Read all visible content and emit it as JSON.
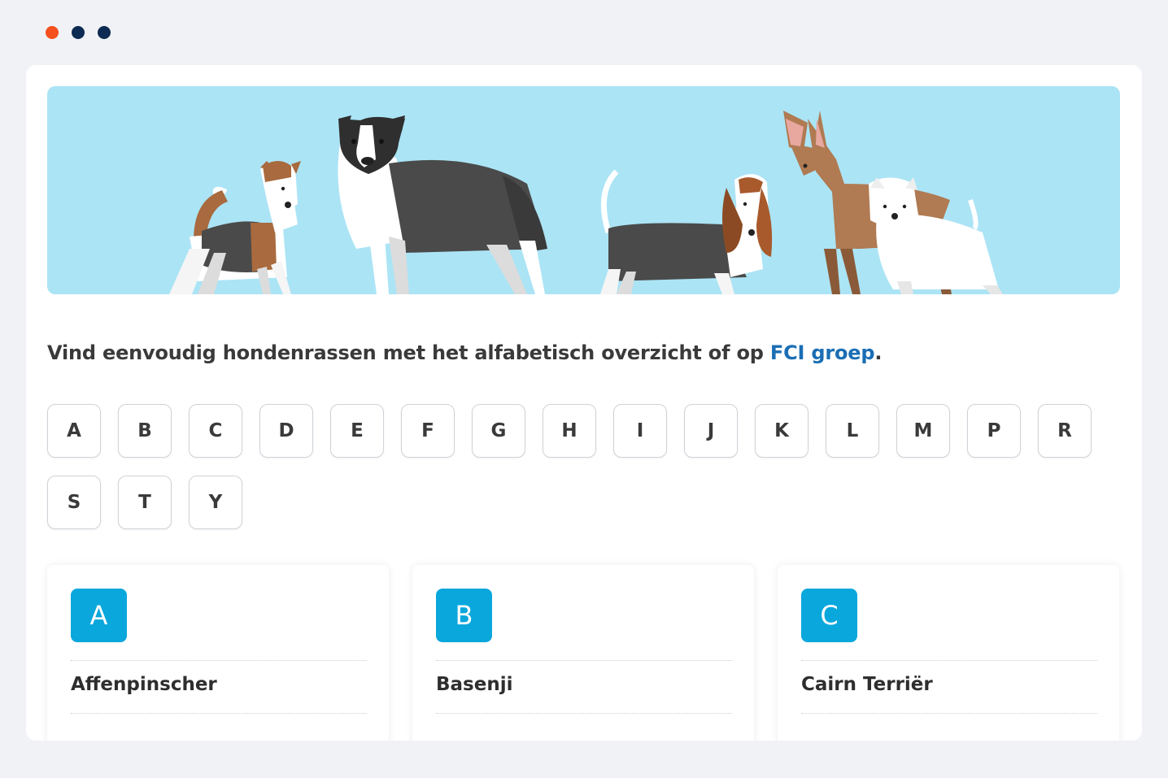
{
  "window": {
    "dot_colors": [
      "#f4511e",
      "#0d2b52",
      "#0d2b52"
    ]
  },
  "intro": {
    "text": "Vind eenvoudig hondenrassen met het alfabetisch overzicht of op ",
    "link": "FCI groep",
    "end": "."
  },
  "letters": [
    "A",
    "B",
    "C",
    "D",
    "E",
    "F",
    "G",
    "H",
    "I",
    "J",
    "K",
    "L",
    "M",
    "P",
    "R",
    "S",
    "T",
    "Y"
  ],
  "cards": [
    {
      "letter": "A",
      "breed": "Affenpinscher"
    },
    {
      "letter": "B",
      "breed": "Basenji"
    },
    {
      "letter": "C",
      "breed": "Cairn Terriër"
    }
  ],
  "colors": {
    "accent": "#0aa7dc",
    "link": "#1a6eb4",
    "hero_background": "#abe4f5"
  }
}
